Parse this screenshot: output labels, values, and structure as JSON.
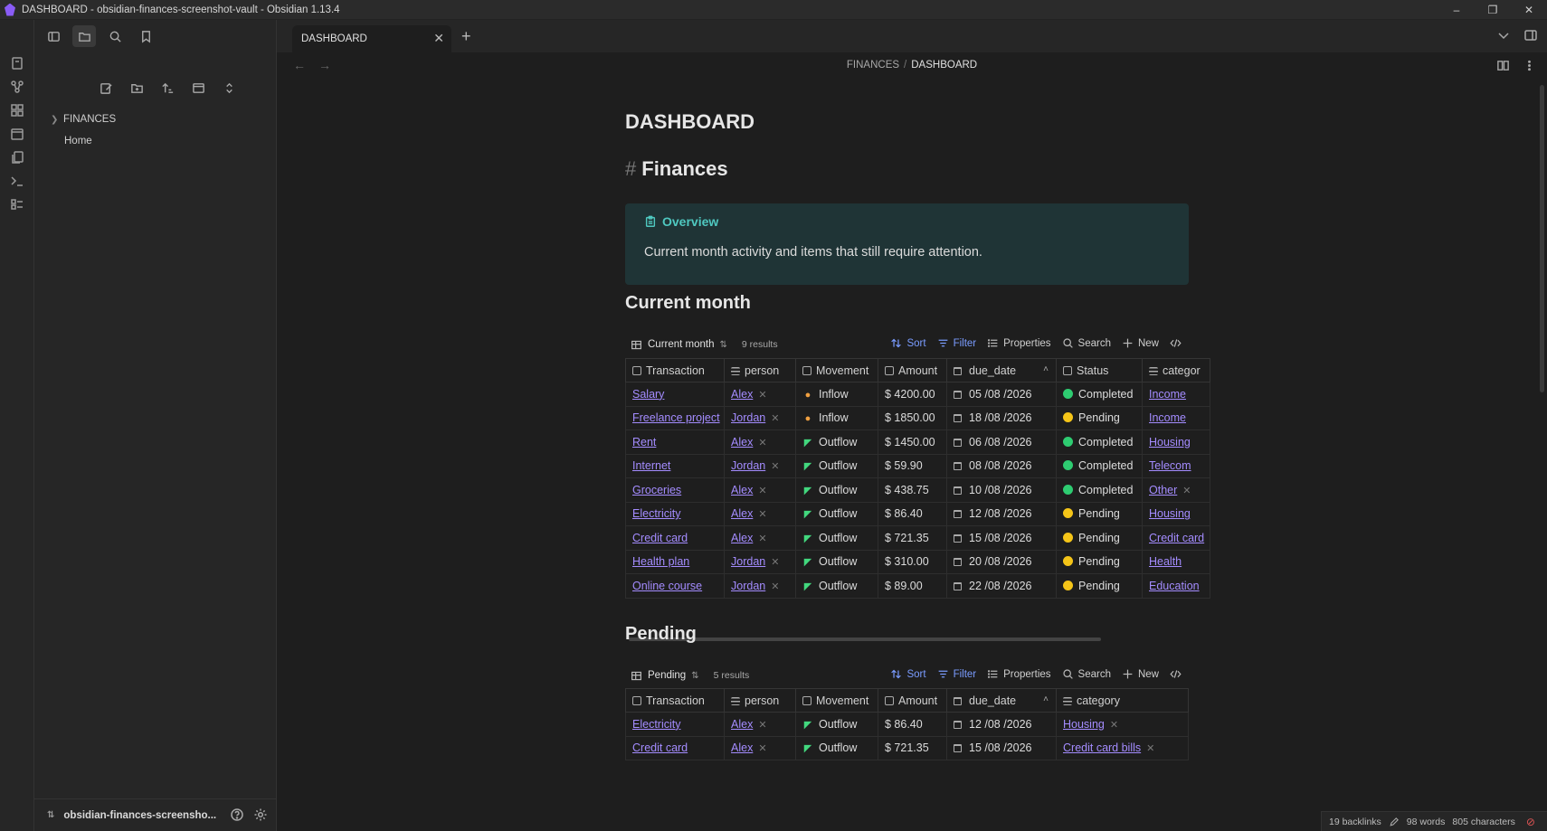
{
  "window": {
    "title": "DASHBOARD - obsidian-finances-screenshot-vault - Obsidian 1.13.4"
  },
  "sidebar": {
    "tree": [
      {
        "label": "FINANCES",
        "type": "folder"
      },
      {
        "label": "Home",
        "type": "file"
      }
    ],
    "vault_name": "obsidian-finances-screensho..."
  },
  "tabs": [
    {
      "label": "DASHBOARD"
    }
  ],
  "breadcrumb": {
    "parent": "FINANCES",
    "separator": "/",
    "current": "DASHBOARD"
  },
  "doc": {
    "title": "DASHBOARD",
    "h1": "Finances",
    "callout": {
      "title": "Overview",
      "body": "Current month activity and items that still require attention."
    }
  },
  "toolbar_labels": {
    "sort": "Sort",
    "filter": "Filter",
    "properties": "Properties",
    "search": "Search",
    "new": "New"
  },
  "current_month": {
    "heading": "Current month",
    "view_name": "Current month",
    "count": "9 results",
    "columns": [
      "Transaction",
      "person",
      "Movement",
      "Amount",
      "due_date",
      "Status",
      "categor"
    ],
    "rows": [
      {
        "transaction": "Salary",
        "person": "Alex",
        "movement": "Inflow",
        "amount": "$ 4200.00",
        "due_date": "05 /08 /2026",
        "status": "Completed",
        "status_color": "#2ecc71",
        "category": "Income"
      },
      {
        "transaction": "Freelance project",
        "person": "Jordan",
        "movement": "Inflow",
        "amount": "$ 1850.00",
        "due_date": "18 /08 /2026",
        "status": "Pending",
        "status_color": "#f5c518",
        "category": "Income"
      },
      {
        "transaction": "Rent",
        "person": "Alex",
        "movement": "Outflow",
        "amount": "$ 1450.00",
        "due_date": "06 /08 /2026",
        "status": "Completed",
        "status_color": "#2ecc71",
        "category": "Housing"
      },
      {
        "transaction": "Internet",
        "person": "Jordan",
        "movement": "Outflow",
        "amount": "$ 59.90",
        "due_date": "08 /08 /2026",
        "status": "Completed",
        "status_color": "#2ecc71",
        "category": "Telecom"
      },
      {
        "transaction": "Groceries",
        "person": "Alex",
        "movement": "Outflow",
        "amount": "$ 438.75",
        "due_date": "10 /08 /2026",
        "status": "Completed",
        "status_color": "#2ecc71",
        "category": "Other"
      },
      {
        "transaction": "Electricity",
        "person": "Alex",
        "movement": "Outflow",
        "amount": "$ 86.40",
        "due_date": "12 /08 /2026",
        "status": "Pending",
        "status_color": "#f5c518",
        "category": "Housing"
      },
      {
        "transaction": "Credit card",
        "person": "Alex",
        "movement": "Outflow",
        "amount": "$ 721.35",
        "due_date": "15 /08 /2026",
        "status": "Pending",
        "status_color": "#f5c518",
        "category": "Credit card"
      },
      {
        "transaction": "Health plan",
        "person": "Jordan",
        "movement": "Outflow",
        "amount": "$ 310.00",
        "due_date": "20 /08 /2026",
        "status": "Pending",
        "status_color": "#f5c518",
        "category": "Health"
      },
      {
        "transaction": "Online course",
        "person": "Jordan",
        "movement": "Outflow",
        "amount": "$ 89.00",
        "due_date": "22 /08 /2026",
        "status": "Pending",
        "status_color": "#f5c518",
        "category": "Education"
      }
    ]
  },
  "pending": {
    "heading": "Pending",
    "view_name": "Pending",
    "count": "5 results",
    "columns": [
      "Transaction",
      "person",
      "Movement",
      "Amount",
      "due_date",
      "category"
    ],
    "rows": [
      {
        "transaction": "Electricity",
        "person": "Alex",
        "movement": "Outflow",
        "amount": "$ 86.40",
        "due_date": "12 /08 /2026",
        "category": "Housing"
      },
      {
        "transaction": "Credit card",
        "person": "Alex",
        "movement": "Outflow",
        "amount": "$ 721.35",
        "due_date": "15 /08 /2026",
        "category": "Credit card bills"
      }
    ]
  },
  "statusbar": {
    "backlinks": "19 backlinks",
    "words": "98 words",
    "characters": "805 characters"
  }
}
